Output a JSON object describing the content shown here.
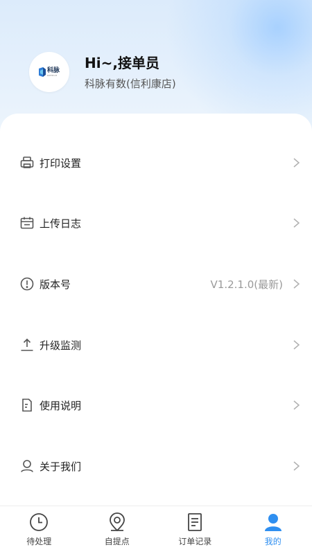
{
  "profile": {
    "greeting": "Hi~,接单员",
    "store": "科脉有数(信利康店)",
    "logo_text": "科脉",
    "logo_sub": "KMTECH"
  },
  "menu": {
    "items": [
      {
        "label": "打印设置",
        "icon": "printer-icon",
        "value": ""
      },
      {
        "label": "上传日志",
        "icon": "calendar-icon",
        "value": ""
      },
      {
        "label": "版本号",
        "icon": "info-circle-icon",
        "value": "V1.2.1.0(最新)"
      },
      {
        "label": "升级监测",
        "icon": "upload-icon",
        "value": ""
      },
      {
        "label": "使用说明",
        "icon": "document-icon",
        "value": ""
      },
      {
        "label": "关于我们",
        "icon": "user-outline-icon",
        "value": ""
      }
    ]
  },
  "tabbar": {
    "tabs": [
      {
        "label": "待处理",
        "icon": "clock-icon",
        "active": false
      },
      {
        "label": "自提点",
        "icon": "location-pin-icon",
        "active": false
      },
      {
        "label": "订单记录",
        "icon": "order-list-icon",
        "active": false
      },
      {
        "label": "我的",
        "icon": "person-icon",
        "active": true
      }
    ]
  },
  "colors": {
    "accent": "#2f8ff0",
    "icon_gray": "#555555",
    "chevron": "#b0b0b0"
  }
}
